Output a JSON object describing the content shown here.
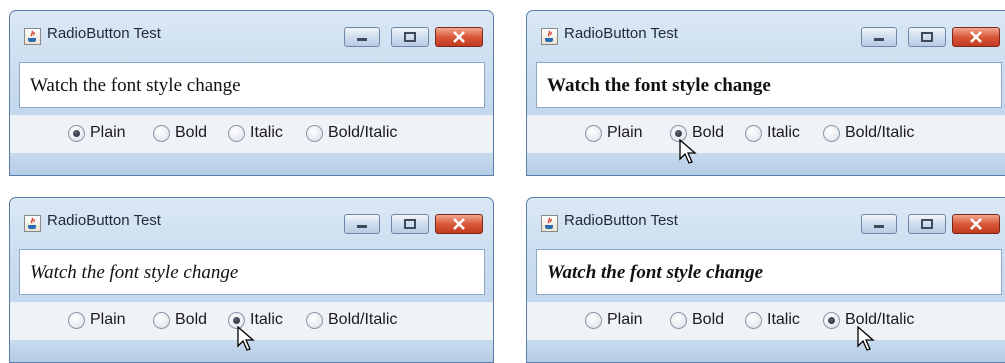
{
  "windows": [
    {
      "title": "RadioButton Test",
      "text": "Watch the font style change",
      "style": "plain",
      "selected": 0
    },
    {
      "title": "RadioButton Test",
      "text": "Watch the font style change",
      "style": "bold",
      "selected": 1
    },
    {
      "title": "RadioButton Test",
      "text": "Watch the font style change",
      "style": "italic",
      "selected": 2
    },
    {
      "title": "RadioButton Test",
      "text": "Watch the font style change",
      "style": "bold-italic",
      "selected": 3
    }
  ],
  "options": [
    "Plain",
    "Bold",
    "Italic",
    "Bold/Italic"
  ],
  "icons": {
    "app": "java-app-icon",
    "minimize": "minimize-icon",
    "maximize": "maximize-icon",
    "close": "close-icon",
    "pointer": "mouse-pointer-icon"
  },
  "colors": {
    "title_bar": "#c9dcef",
    "close_button": "#d9583a",
    "window_border": "#5a7ea8"
  }
}
